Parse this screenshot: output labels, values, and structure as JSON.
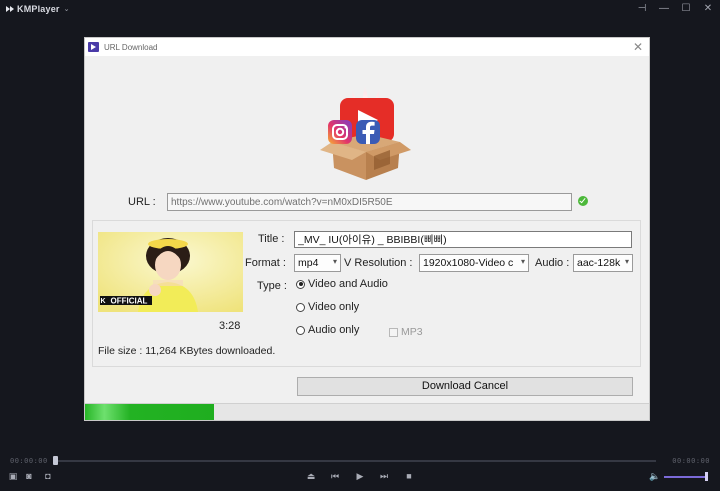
{
  "app": {
    "name": "KMPlayer"
  },
  "window_controls": {
    "pin": "⊣",
    "minimize": "—",
    "maximize": "☐",
    "close": "✕"
  },
  "dialog": {
    "title": "URL Download",
    "url_label": "URL :",
    "url_value": "https://www.youtube.com/watch?v=nM0xDI5R50E",
    "title_label": "Title :",
    "title_value": "_MV_ IU(아이유) _ BBIBBI(삐삐)",
    "format_label": "Format :",
    "format_value": "mp4",
    "resolution_label": "V Resolution :",
    "resolution_value": "1920x1080-Video c",
    "audio_label": "Audio :",
    "audio_value": "aac-128k",
    "type_label": "Type :",
    "type_options": [
      {
        "label": "Video and Audio",
        "selected": true
      },
      {
        "label": "Video only",
        "selected": false
      },
      {
        "label": "Audio only",
        "selected": false
      }
    ],
    "mp3_label": "MP3",
    "mp3_checked": false,
    "duration": "3:28",
    "thumbnail_badge": "OFFICIAL",
    "thumbnail_badge_k": "K",
    "file_size": "File size : 11,264 KBytes downloaded.",
    "download_button": "Download Cancel",
    "progress_fraction": 0.228
  },
  "player": {
    "time_left": "00:00:00",
    "time_right": "00:00:00",
    "volume_fraction": 0.93
  },
  "colors": {
    "accent": "#7b6ad8",
    "progress": "#23b223",
    "dialog_bg": "#f0f0f0"
  }
}
